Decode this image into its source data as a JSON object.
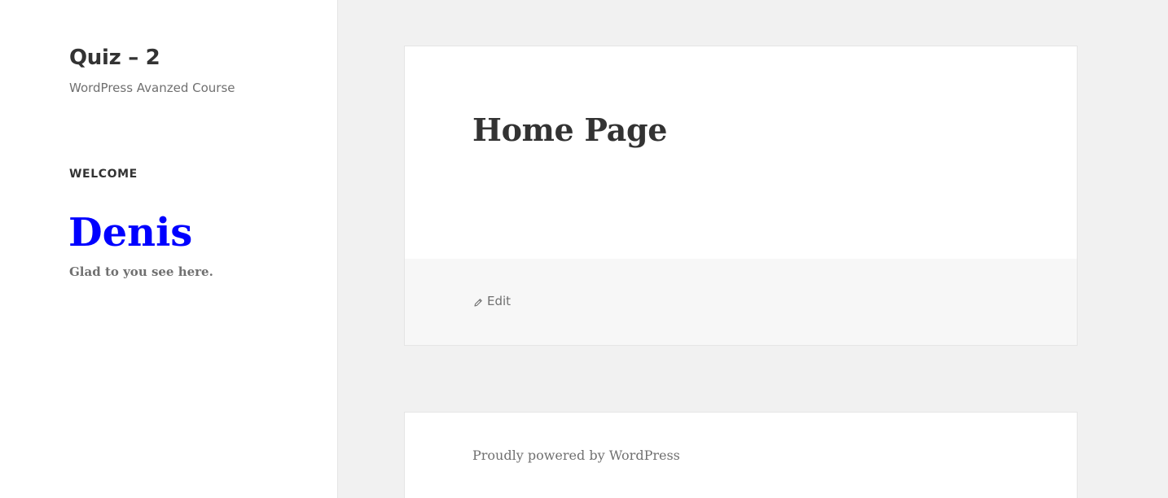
{
  "site": {
    "title": "Quiz – 2",
    "description": "WordPress Avanzed Course"
  },
  "widget": {
    "title": "WELCOME",
    "name": "Denis",
    "message": "Glad to you see here.",
    "name_color": "#0000ff"
  },
  "article": {
    "title": "Home Page",
    "edit_label": "Edit",
    "edit_icon": "pencil-icon"
  },
  "footer": {
    "credit": "Proudly powered by WordPress"
  }
}
